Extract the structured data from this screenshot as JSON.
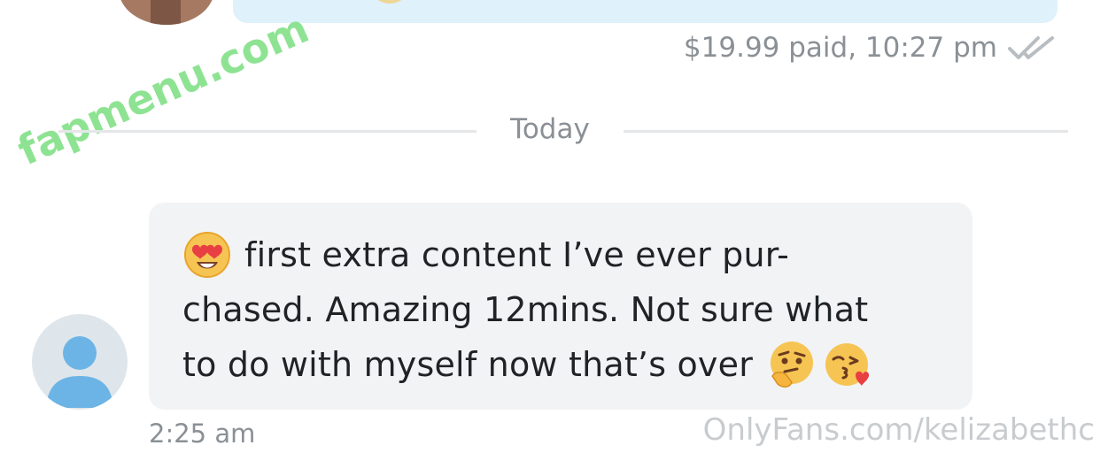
{
  "previous_message": {
    "status": "$19.99 paid, 10:27 pm",
    "status_icon": "double-check-icon"
  },
  "divider": {
    "label": "Today"
  },
  "message": {
    "lines": [
      "first extra content I’ve ever pur-",
      "chased. Amazing 12mins. Not sure what",
      "to do with myself now that’s over"
    ],
    "emojis": [
      "heart-eyes-emoji",
      "thinking-face-emoji",
      "kissing-heart-emoji"
    ],
    "time": "2:25 am"
  },
  "watermarks": {
    "top": "fapmenu.com",
    "bottom": "OnlyFans.com/kelizabethc"
  },
  "colors": {
    "incoming_bubble": "#f2f3f4",
    "outgoing_bubble": "#dff1fb",
    "meta_text": "#8a9095",
    "avatar_accent": "#6db4e6",
    "watermark_green": "#8ee393"
  }
}
